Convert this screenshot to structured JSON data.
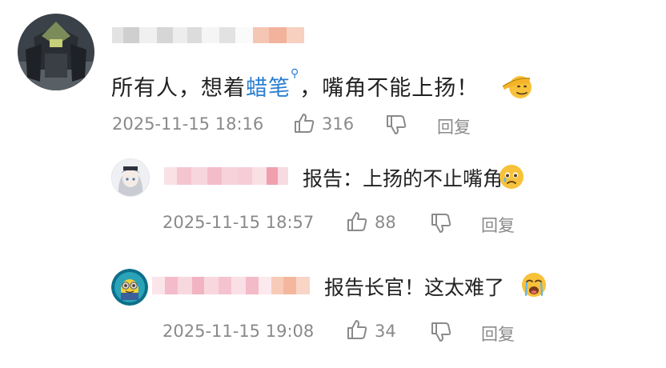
{
  "comments": [
    {
      "text_prefix": "所有人，想着",
      "link_text": "蜡笔",
      "search_mark": "⚲",
      "text_suffix": "，嘴角不能上扬！",
      "timestamp": "2025-11-15 18:16",
      "likes": "316",
      "reply_label": "回复",
      "emoji_icon": "saluting-face"
    }
  ],
  "replies": [
    {
      "text": "报告：上扬的不止嘴角",
      "timestamp": "2025-11-15 18:57",
      "likes": "88",
      "reply_label": "回复",
      "emoji_icon": "face-holding-back-tears"
    },
    {
      "text": "报告长官！这太难了",
      "timestamp": "2025-11-15 19:08",
      "likes": "34",
      "reply_label": "回复",
      "emoji_icon": "loudly-crying-face"
    }
  ],
  "colors": {
    "link": "#2a7fd0",
    "meta": "#8a8a8a",
    "text": "#222222"
  }
}
